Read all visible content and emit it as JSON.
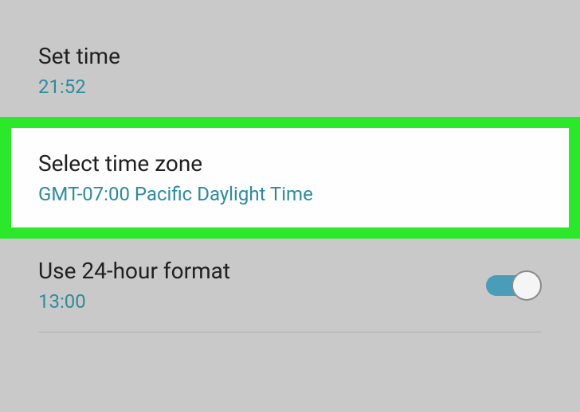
{
  "settings": {
    "setTime": {
      "title": "Set time",
      "value": "21:52"
    },
    "selectTimeZone": {
      "title": "Select time zone",
      "value": "GMT-07:00 Pacific Daylight Time"
    },
    "use24Hour": {
      "title": "Use 24-hour format",
      "value": "13:00",
      "enabled": true
    }
  },
  "colors": {
    "highlight": "#2be82b",
    "accent": "#2e8b9e",
    "toggleTrack": "#4a9db8"
  }
}
